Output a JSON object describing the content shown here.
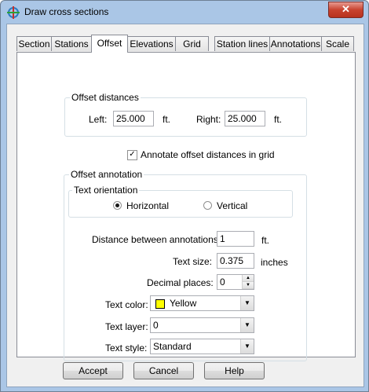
{
  "window": {
    "title": "Draw cross sections",
    "close_label": "✕"
  },
  "tabs": [
    {
      "label": "Section"
    },
    {
      "label": "Stations"
    },
    {
      "label": "Offset"
    },
    {
      "label": "Elevations"
    },
    {
      "label": "Grid"
    },
    {
      "label": "Station lines"
    },
    {
      "label": "Annotations"
    },
    {
      "label": "Scale"
    }
  ],
  "active_tab": "Offset",
  "offset_distances": {
    "group_label": "Offset distances",
    "left_label": "Left:",
    "left_value": "25.000",
    "left_unit": "ft.",
    "right_label": "Right:",
    "right_value": "25.000",
    "right_unit": "ft."
  },
  "annotate_offsets": {
    "label": "Annotate offset distances in grid",
    "checked": true,
    "check_mark": "✓"
  },
  "offset_annotation": {
    "group_label": "Offset annotation",
    "text_orientation": {
      "group_label": "Text orientation",
      "horizontal_label": "Horizontal",
      "vertical_label": "Vertical",
      "selected": "Horizontal"
    },
    "distance_label": "Distance between annotations:",
    "distance_value": "1",
    "distance_unit": "ft.",
    "text_size_label": "Text size:",
    "text_size_value": "0.375",
    "text_size_unit": "inches",
    "decimal_label": "Decimal places:",
    "decimal_value": "0",
    "text_color_label": "Text color:",
    "text_color_value": "Yellow",
    "text_color_hex": "#ffff00",
    "text_layer_label": "Text layer:",
    "text_layer_value": "0",
    "text_style_label": "Text style:",
    "text_style_value": "Standard"
  },
  "buttons": {
    "accept": "Accept",
    "cancel": "Cancel",
    "help": "Help"
  }
}
